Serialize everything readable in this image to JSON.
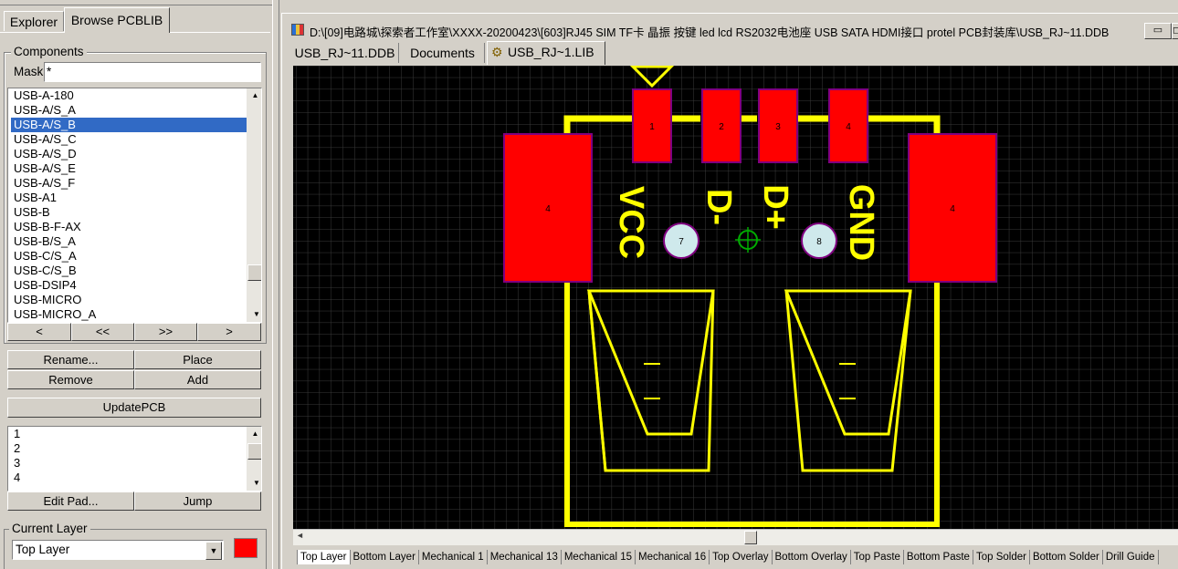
{
  "panel_tabs": [
    "Explorer",
    "Browse PCBLIB"
  ],
  "components": {
    "title": "Components",
    "mask_label": "Mask",
    "mask_value": "*",
    "items": [
      "USB-A-180",
      "USB-A/S_A",
      "USB-A/S_B",
      "USB-A/S_C",
      "USB-A/S_D",
      "USB-A/S_E",
      "USB-A/S_F",
      "USB-A1",
      "USB-B",
      "USB-B-F-AX",
      "USB-B/S_A",
      "USB-C/S_A",
      "USB-C/S_B",
      "USB-DSIP4",
      "USB-MICRO",
      "USB-MICRO_A"
    ],
    "selected": "USB-A/S_B",
    "nav": [
      "<",
      "<<",
      ">>",
      ">"
    ]
  },
  "buttons": {
    "rename": "Rename...",
    "place": "Place",
    "remove": "Remove",
    "add": "Add",
    "update_pcb": "UpdatePCB",
    "edit_pad": "Edit Pad...",
    "jump": "Jump"
  },
  "pads_list": [
    "1",
    "2",
    "3",
    "4"
  ],
  "current_layer": {
    "title": "Current Layer",
    "value": "Top Layer",
    "color": "#ff0000"
  },
  "window": {
    "title": "D:\\[09]电路城\\探索者工作室\\XXXX-20200423\\[603]RJ45 SIM TF卡 晶振 按键 led lcd RS2032电池座 USB SATA HDMI接口 protel PCB封装库\\USB_RJ~11.DDB"
  },
  "doc_tabs": [
    "USB_RJ~11.DDB",
    "Documents",
    "USB_RJ~1.LIB"
  ],
  "layer_tabs": [
    "Top Layer",
    "Bottom Layer",
    "Mechanical 1",
    "Mechanical 13",
    "Mechanical 15",
    "Mechanical 16",
    "Top Overlay",
    "Bottom Overlay",
    "Top Paste",
    "Bottom Paste",
    "Top Solder",
    "Bottom Solder",
    "Drill Guide"
  ],
  "pcb": {
    "pad_labels": [
      "1",
      "2",
      "3",
      "4"
    ],
    "mount_pad_label": "4",
    "hole_labels": [
      "7",
      "8"
    ],
    "silk_text": [
      "VCC",
      "D-",
      "D+",
      "GND"
    ]
  },
  "colors": {
    "pad": "#ff0000",
    "silk": "#ffff00",
    "grid": "#3a3a3a",
    "canvas": "#000000",
    "selection": "#316ac5"
  }
}
